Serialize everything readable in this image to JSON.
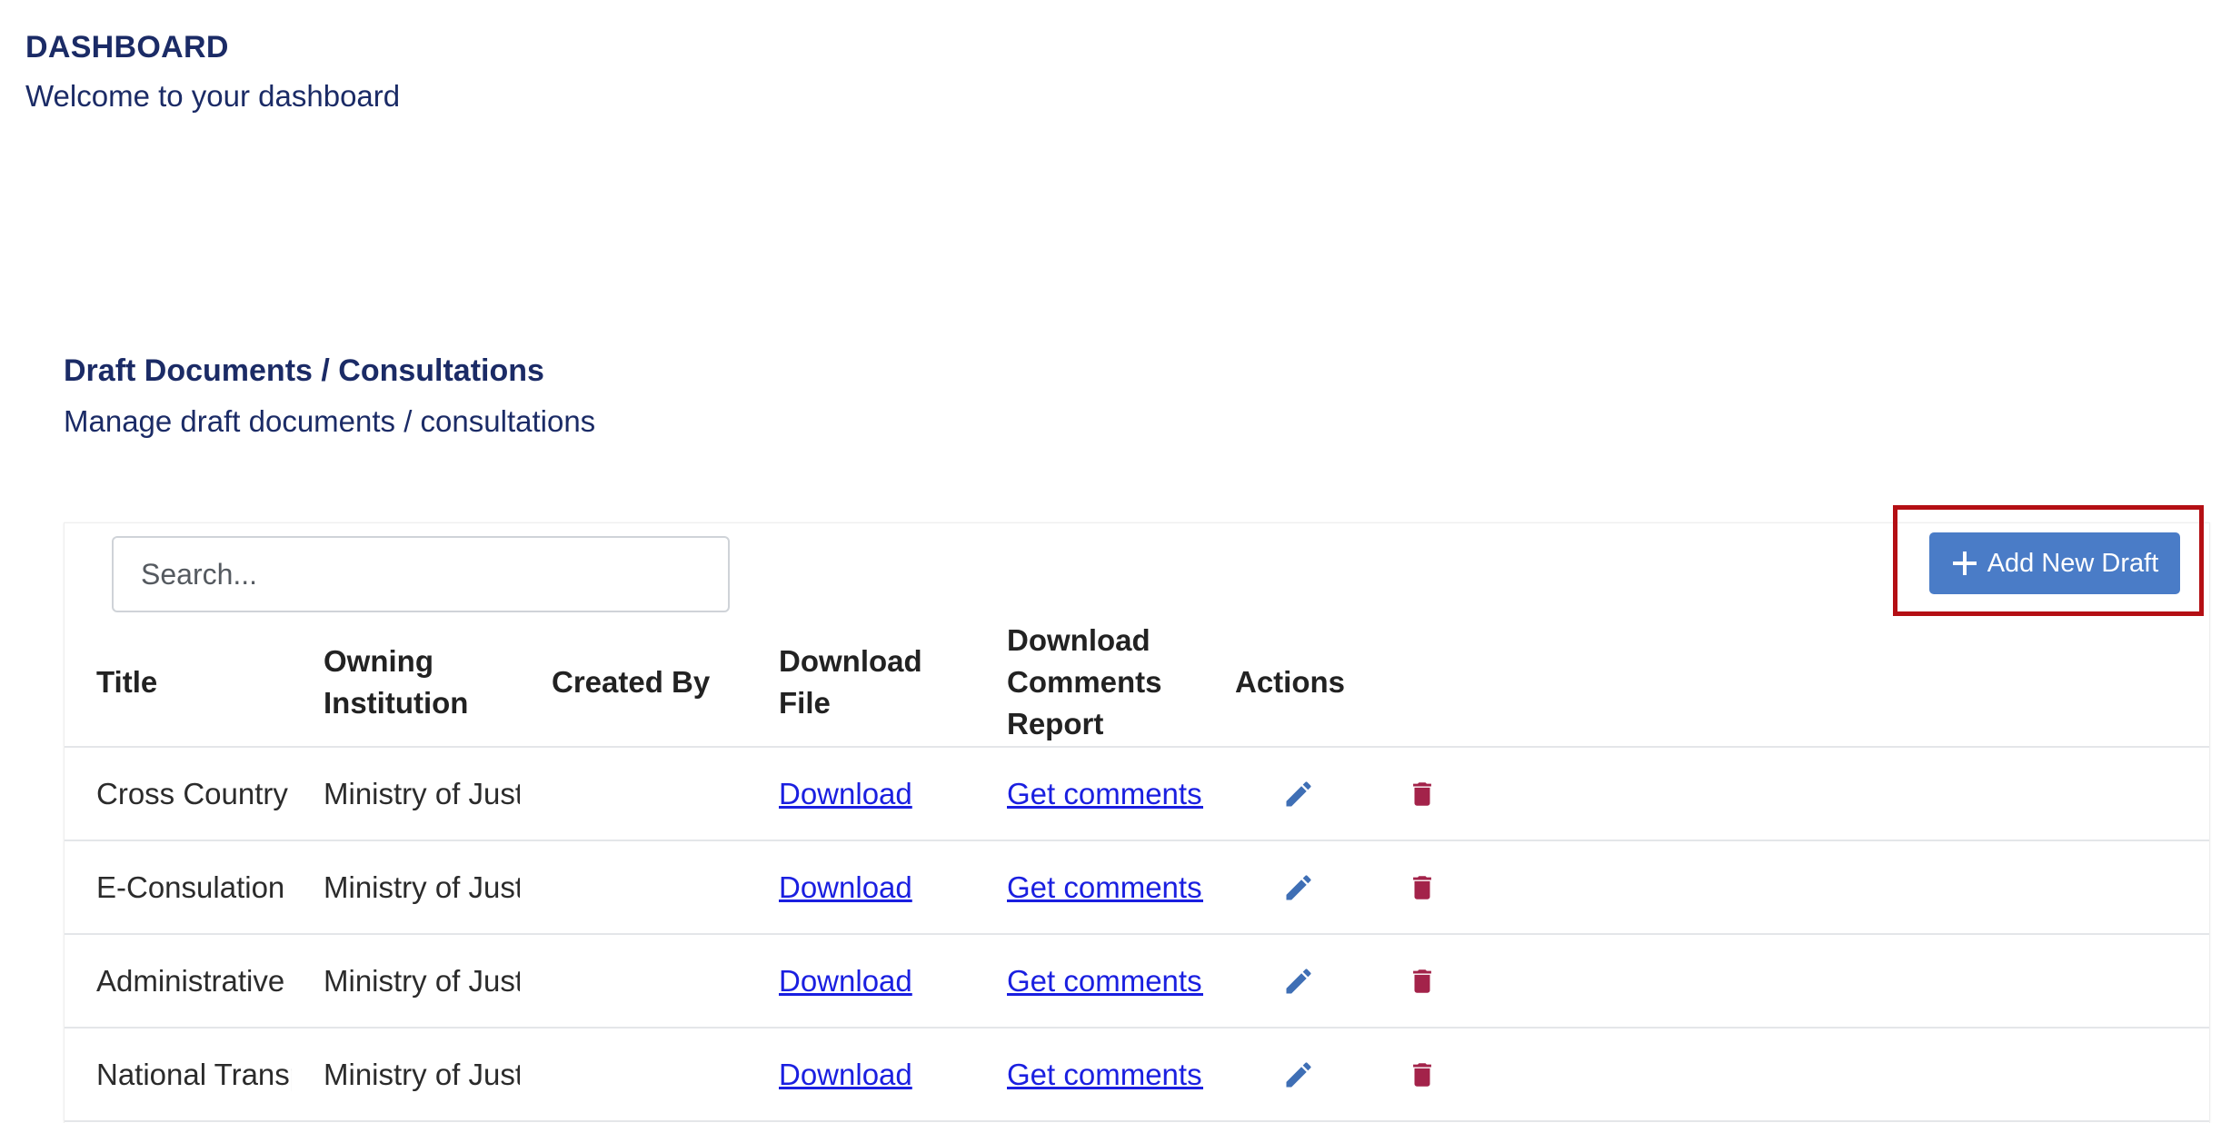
{
  "page": {
    "title": "DASHBOARD",
    "subtitle": "Welcome to your dashboard"
  },
  "section": {
    "title": "Draft Documents / Consultations",
    "subtitle": "Manage draft documents / consultations"
  },
  "search": {
    "placeholder": "Search..."
  },
  "toolbar": {
    "add_label": "Add New Draft",
    "add_icon": "plus-icon",
    "highlight_color": "#b40f14",
    "button_color": "#4a7cc7"
  },
  "table": {
    "headers": {
      "title": "Title",
      "owning_institution": "Owning Institution",
      "created_by": "Created By",
      "download_file": "Download File",
      "download_comments_report": "Download Comments Report",
      "actions": "Actions"
    },
    "rows": [
      {
        "title": "Cross Country Transp",
        "owning_institution": "Ministry of Justice",
        "created_by": "",
        "download_file": "Download",
        "comments_report": "Get comments report"
      },
      {
        "title": "E-Consulation Procla",
        "owning_institution": "Ministry of Justice",
        "created_by": "",
        "download_file": "Download",
        "comments_report": "Get comments report"
      },
      {
        "title": "Administrative Procl",
        "owning_institution": "Ministry of Justice",
        "created_by": "",
        "download_file": "Download",
        "comments_report": "Get comments report"
      },
      {
        "title": "National Transport R",
        "owning_institution": "Ministry of Justice",
        "created_by": "",
        "download_file": "Download",
        "comments_report": "Get comments report"
      }
    ],
    "action_icons": {
      "edit": "pencil-icon",
      "delete": "trash-icon",
      "edit_color": "#3f6fb5",
      "delete_color": "#a3234a"
    }
  }
}
